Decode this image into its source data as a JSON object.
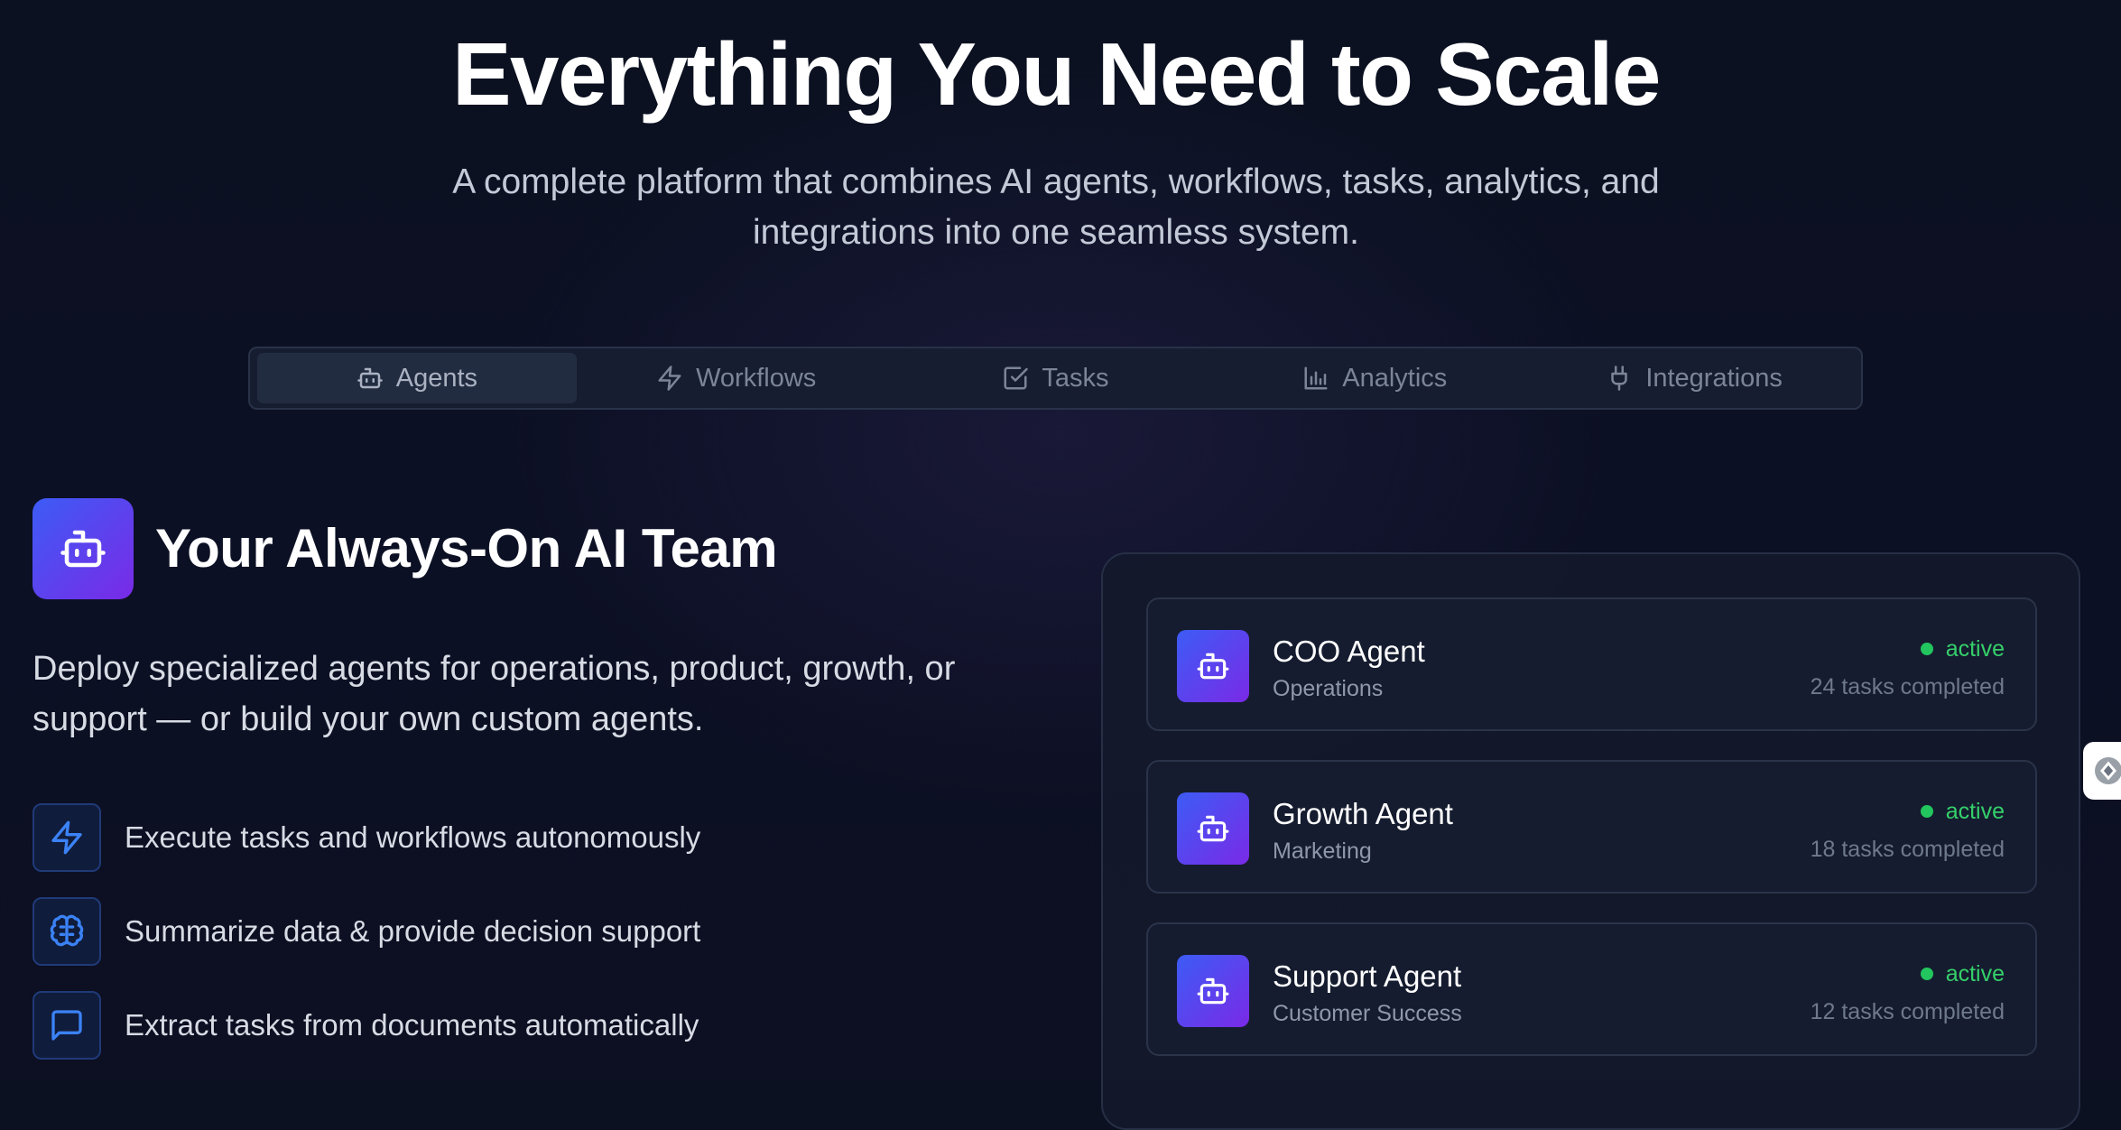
{
  "hero": {
    "title": "Everything You Need to Scale",
    "subtitle_line1": "A complete platform that combines AI agents, workflows, tasks, analytics, and",
    "subtitle_line2": "integrations into one seamless system."
  },
  "tabs": [
    {
      "label": "Agents",
      "icon": "bot-icon",
      "active": true
    },
    {
      "label": "Workflows",
      "icon": "lightning-icon",
      "active": false
    },
    {
      "label": "Tasks",
      "icon": "checkbox-icon",
      "active": false
    },
    {
      "label": "Analytics",
      "icon": "bar-chart-icon",
      "active": false
    },
    {
      "label": "Integrations",
      "icon": "plug-icon",
      "active": false
    }
  ],
  "section": {
    "icon": "bot-icon",
    "title": "Your Always-On AI Team",
    "description_line1": "Deploy specialized agents for operations, product, growth, or",
    "description_line2": "support — or build your own custom agents.",
    "features": [
      {
        "icon": "lightning-icon",
        "text": "Execute tasks and workflows autonomously"
      },
      {
        "icon": "brain-icon",
        "text": "Summarize data & provide decision support"
      },
      {
        "icon": "message-icon",
        "text": "Extract tasks from documents automatically"
      }
    ]
  },
  "agents": [
    {
      "name": "COO Agent",
      "department": "Operations",
      "status": "active",
      "tasks": "24 tasks completed"
    },
    {
      "name": "Growth Agent",
      "department": "Marketing",
      "status": "active",
      "tasks": "18 tasks completed"
    },
    {
      "name": "Support Agent",
      "department": "Customer Success",
      "status": "active",
      "tasks": "12 tasks completed"
    }
  ],
  "colors": {
    "background": "#0b1120",
    "accent_gradient_start": "#3c5cf6",
    "accent_gradient_end": "#7a2ae6",
    "status_active": "#22c55e",
    "feature_icon": "#3b82f6"
  }
}
